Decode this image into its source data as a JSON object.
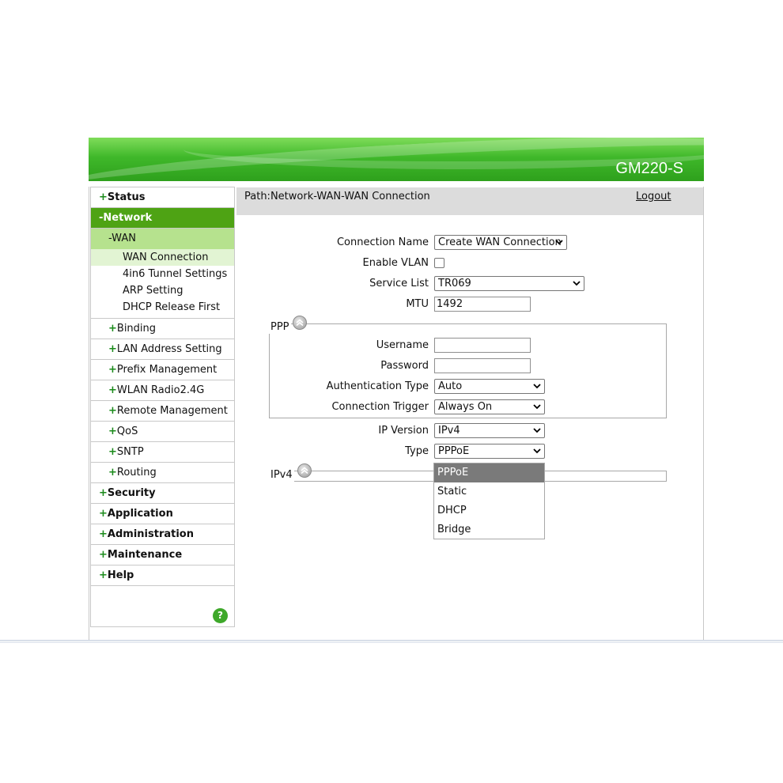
{
  "header": {
    "model": "GM220-S"
  },
  "sidebar": {
    "items": [
      {
        "prefix": "+",
        "label": "Status"
      },
      {
        "prefix": "-",
        "label": "Network"
      }
    ],
    "network_sub": [
      {
        "prefix": "-",
        "label": "WAN"
      }
    ],
    "wan_leaves": [
      "WAN Connection",
      "4in6 Tunnel Settings",
      "ARP Setting",
      "DHCP Release First"
    ],
    "network_rest": [
      {
        "prefix": "+",
        "label": "Binding"
      },
      {
        "prefix": "+",
        "label": "LAN Address Setting"
      },
      {
        "prefix": "+",
        "label": "Prefix Management"
      },
      {
        "prefix": "+",
        "label": "WLAN Radio2.4G"
      },
      {
        "prefix": "+",
        "label": "Remote Management"
      },
      {
        "prefix": "+",
        "label": "QoS"
      },
      {
        "prefix": "+",
        "label": "SNTP"
      },
      {
        "prefix": "+",
        "label": "Routing"
      }
    ],
    "top_rest": [
      {
        "prefix": "+",
        "label": "Security"
      },
      {
        "prefix": "+",
        "label": "Application"
      },
      {
        "prefix": "+",
        "label": "Administration"
      },
      {
        "prefix": "+",
        "label": "Maintenance"
      },
      {
        "prefix": "+",
        "label": "Help"
      }
    ],
    "help_icon": "?"
  },
  "pathbar": {
    "path": "Path:Network-WAN-WAN Connection",
    "logout": "Logout"
  },
  "form": {
    "connection_name": {
      "label": "Connection Name",
      "value": "Create WAN Connection"
    },
    "enable_vlan": {
      "label": "Enable VLAN",
      "checked": false
    },
    "service_list": {
      "label": "Service List",
      "value": "TR069"
    },
    "mtu": {
      "label": "MTU",
      "value": "1492"
    },
    "ppp": {
      "title": "PPP",
      "username": {
        "label": "Username",
        "value": ""
      },
      "password": {
        "label": "Password",
        "value": ""
      },
      "auth_type": {
        "label": "Authentication Type",
        "value": "Auto"
      },
      "conn_trigger": {
        "label": "Connection Trigger",
        "value": "Always On"
      }
    },
    "ip_version": {
      "label": "IP Version",
      "value": "IPv4"
    },
    "type": {
      "label": "Type",
      "value": "PPPoE",
      "options": [
        "PPPoE",
        "Static",
        "DHCP",
        "Bridge"
      ]
    },
    "ipv4": {
      "title": "IPv4"
    }
  },
  "colors": {
    "accent": "#4ea314",
    "plus": "#1a8a1a",
    "banner": "#3fb82a"
  }
}
